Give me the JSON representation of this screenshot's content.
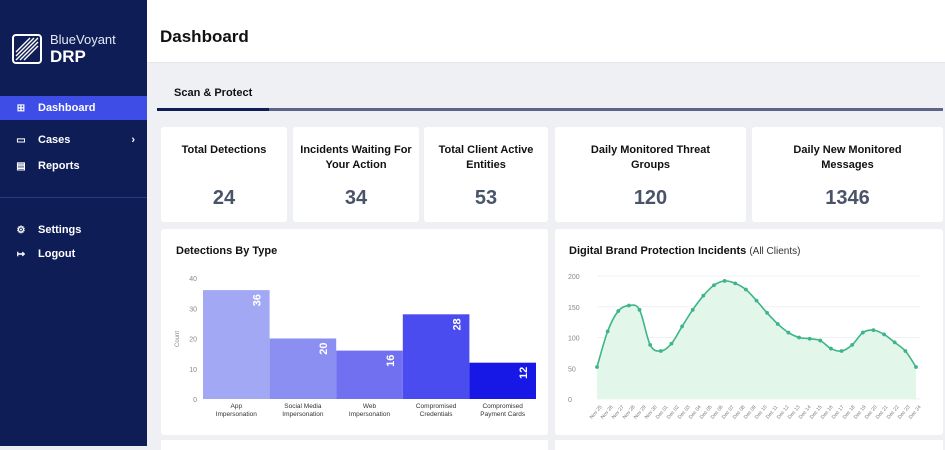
{
  "brand": {
    "sub": "BlueVoyant",
    "main": "DRP"
  },
  "nav": {
    "dashboard": "Dashboard",
    "cases": "Cases",
    "reports": "Reports",
    "settings": "Settings",
    "logout": "Logout"
  },
  "header": {
    "title": "Dashboard"
  },
  "tabs": [
    {
      "label": "Scan & Protect",
      "active": true
    }
  ],
  "stats": [
    {
      "label": "Total Detections",
      "value": "24"
    },
    {
      "label": "Incidents Waiting For Your Action",
      "value": "34"
    },
    {
      "label": "Total Client Active Entities",
      "value": "53"
    },
    {
      "label": "Daily Monitored Threat Groups",
      "value": "120"
    },
    {
      "label": "Daily New Monitored Messages",
      "value": "1346"
    }
  ],
  "colors": {
    "sidebar": "#0f1d57",
    "accent": "#3d4de6",
    "line": "#3eb489",
    "area": "#e2f6ea"
  },
  "chart_data": [
    {
      "type": "bar",
      "title": "Detections By Type",
      "ylabel": "Count",
      "ylim": [
        0,
        40
      ],
      "yticks": [
        0,
        10,
        20,
        30,
        40
      ],
      "categories": [
        "App Impersonation",
        "Social Media Impersonation",
        "Web Impersonation",
        "Compromised Credentials",
        "Compromised Payment Cards"
      ],
      "category_lines": [
        [
          "App",
          "Impersonation"
        ],
        [
          "Social Media",
          "Impersonation"
        ],
        [
          "Web",
          "Impersonation"
        ],
        [
          "Compromised",
          "Credentials"
        ],
        [
          "Compromised",
          "Payment Cards"
        ]
      ],
      "values": [
        36,
        20,
        16,
        28,
        12
      ],
      "colors": [
        "#a3a8f5",
        "#8b8ff2",
        "#7070f0",
        "#4b4cf0",
        "#1717e6"
      ]
    },
    {
      "type": "area",
      "title": "Digital Brand Protection Incidents",
      "subtitle": "(All Clients)",
      "ylim": [
        0,
        200
      ],
      "yticks": [
        0,
        50,
        100,
        150,
        200
      ],
      "x": [
        "Nov 25",
        "Nov 26",
        "Nov 27",
        "Nov 28",
        "Nov 29",
        "Nov 30",
        "Dec 01",
        "Dec 02",
        "Dec 03",
        "Dec 04",
        "Dec 05",
        "Dec 06",
        "Dec 07",
        "Dec 08",
        "Dec 09",
        "Dec 10",
        "Dec 11",
        "Dec 12",
        "Dec 13",
        "Dec 14",
        "Dec 15",
        "Dec 16",
        "Dec 17",
        "Dec 18",
        "Dec 19",
        "Dec 20",
        "Dec 21",
        "Dec 22",
        "Dec 23",
        "Dec 24"
      ],
      "values": [
        52,
        110,
        143,
        152,
        145,
        88,
        78,
        90,
        118,
        145,
        168,
        185,
        192,
        188,
        178,
        160,
        140,
        122,
        108,
        100,
        98,
        95,
        82,
        78,
        88,
        108,
        112,
        105,
        92,
        78,
        52
      ]
    }
  ]
}
